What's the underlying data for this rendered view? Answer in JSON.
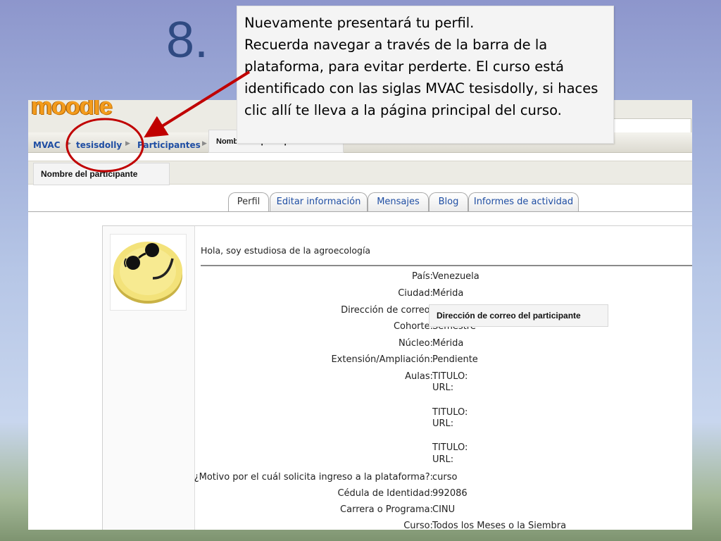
{
  "slide": {
    "number": "8."
  },
  "callout": {
    "line1": "Nuevamente presentará tu perfil.",
    "line2": "Recuerda  navegar a través de la barra de la plataforma, para evitar perderte. El curso está identificado con las siglas MVAC tesisdolly, si haces clic allí te lleva a la página principal del curso."
  },
  "moodle": {
    "logo_text": "moodle",
    "breadcrumb": [
      "MVAC",
      "tesisdolly",
      "Participantes"
    ],
    "breadcrumb_overlay": "Nombre del participante",
    "participant_name_box": "Nombre del participante",
    "tabs": [
      {
        "label": "Perfil",
        "active": true
      },
      {
        "label": "Editar información",
        "active": false
      },
      {
        "label": "Mensajes",
        "active": false
      },
      {
        "label": "Blog",
        "active": false
      },
      {
        "label": "Informes de actividad",
        "active": false
      }
    ],
    "description": "Hola, soy estudiosa de la agroecología",
    "email_overlay": "Dirección de correo del participante",
    "fields": [
      {
        "label": "País:",
        "value": "Venezuela"
      },
      {
        "label": "Ciudad:",
        "value": "Mérida"
      },
      {
        "label": "Dirección de correo:",
        "value": ""
      },
      {
        "label": "Cohorte:",
        "value": "Semestre"
      },
      {
        "label": "Núcleo:",
        "value": "Mérida"
      },
      {
        "label": "Extensión/Ampliación:",
        "value": "Pendiente"
      },
      {
        "label": "Aulas:",
        "value": "TITULO:"
      },
      {
        "label": "",
        "value": "URL:"
      },
      {
        "label": "",
        "value": "TITULO:"
      },
      {
        "label": "",
        "value": "URL:"
      },
      {
        "label": "",
        "value": "TITULO:"
      },
      {
        "label": "",
        "value": "URL:"
      },
      {
        "label": "¿Motivo por el cuál solicita ingreso a la plataforma?:",
        "value": "curso"
      },
      {
        "label": "Cédula de Identidad:",
        "value": "992086"
      },
      {
        "label": "Carrera o Programa:",
        "value": "CINU"
      },
      {
        "label": "Curso:",
        "value": "Todos los Meses o la Siembra"
      }
    ],
    "icons": {
      "avatar": "smiley-face-icon",
      "breadcrumb_separator": "triangle-right-icon"
    }
  },
  "colors": {
    "accent_arrow": "#c00000",
    "link": "#1f4ea3",
    "logo": "#f39c1d"
  }
}
